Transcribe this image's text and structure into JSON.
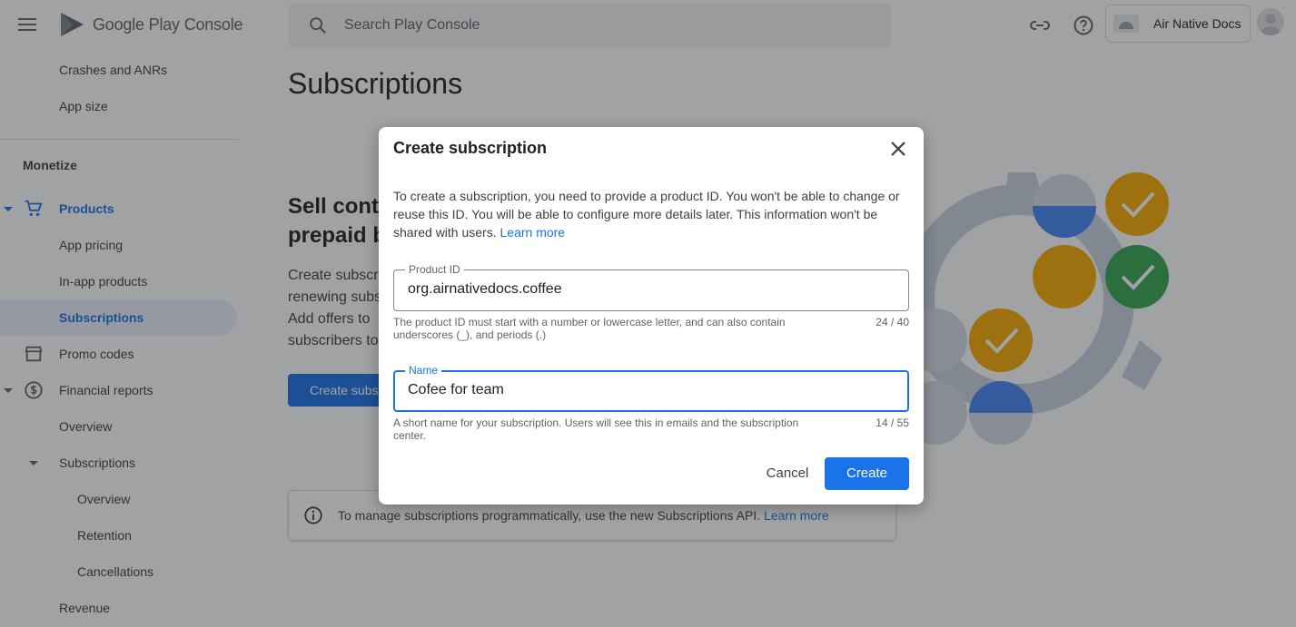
{
  "header": {
    "logo_text_a": "Google Play",
    "logo_text_b": "Console",
    "search_placeholder": "Search Play Console",
    "account_name": "Air Native Docs"
  },
  "sidebar": {
    "items_top": [
      "Crashes and ANRs",
      "App size"
    ],
    "section": "Monetize",
    "products": "Products",
    "product_children": [
      "App pricing",
      "In-app products",
      "Subscriptions"
    ],
    "promo_codes": "Promo codes",
    "financial_reports": "Financial reports",
    "fr_overview": "Overview",
    "fr_subscriptions": "Subscriptions",
    "fr_sub_children": [
      "Overview",
      "Retention",
      "Cancellations"
    ],
    "revenue": "Revenue"
  },
  "main": {
    "title": "Subscriptions",
    "promo_heading": "Sell conte\nprepaid b",
    "promo_body": "Create subscr\nrenewing subs\nAdd offers to\nsubscribers to",
    "promo_button": "Create subs",
    "info_text": "To manage subscriptions programmatically, use the new Subscriptions API.",
    "info_link": "Learn more"
  },
  "dialog": {
    "title": "Create subscription",
    "description": "To create a subscription, you need to provide a product ID. You won't be able to change or reuse this ID. You will be able to configure more details later. This information won't be shared with users.",
    "learn_more": "Learn more",
    "product_id": {
      "label": "Product ID",
      "value": "org.airnativedocs.coffee",
      "helper": "The product ID must start with a number or lowercase letter, and can also contain underscores (_), and periods (.)",
      "counter": "24 / 40"
    },
    "name": {
      "label": "Name",
      "value": "Cofee for team",
      "helper": "A short name for your subscription. Users will see this in emails and the subscription center.",
      "counter": "14 / 55"
    },
    "cancel_label": "Cancel",
    "create_label": "Create"
  },
  "colors": {
    "accent": "#1a73e8",
    "overlay": "#202124",
    "illus_blue": "#4285f4",
    "illus_yellow": "#f9ab00",
    "illus_green": "#34a853"
  }
}
